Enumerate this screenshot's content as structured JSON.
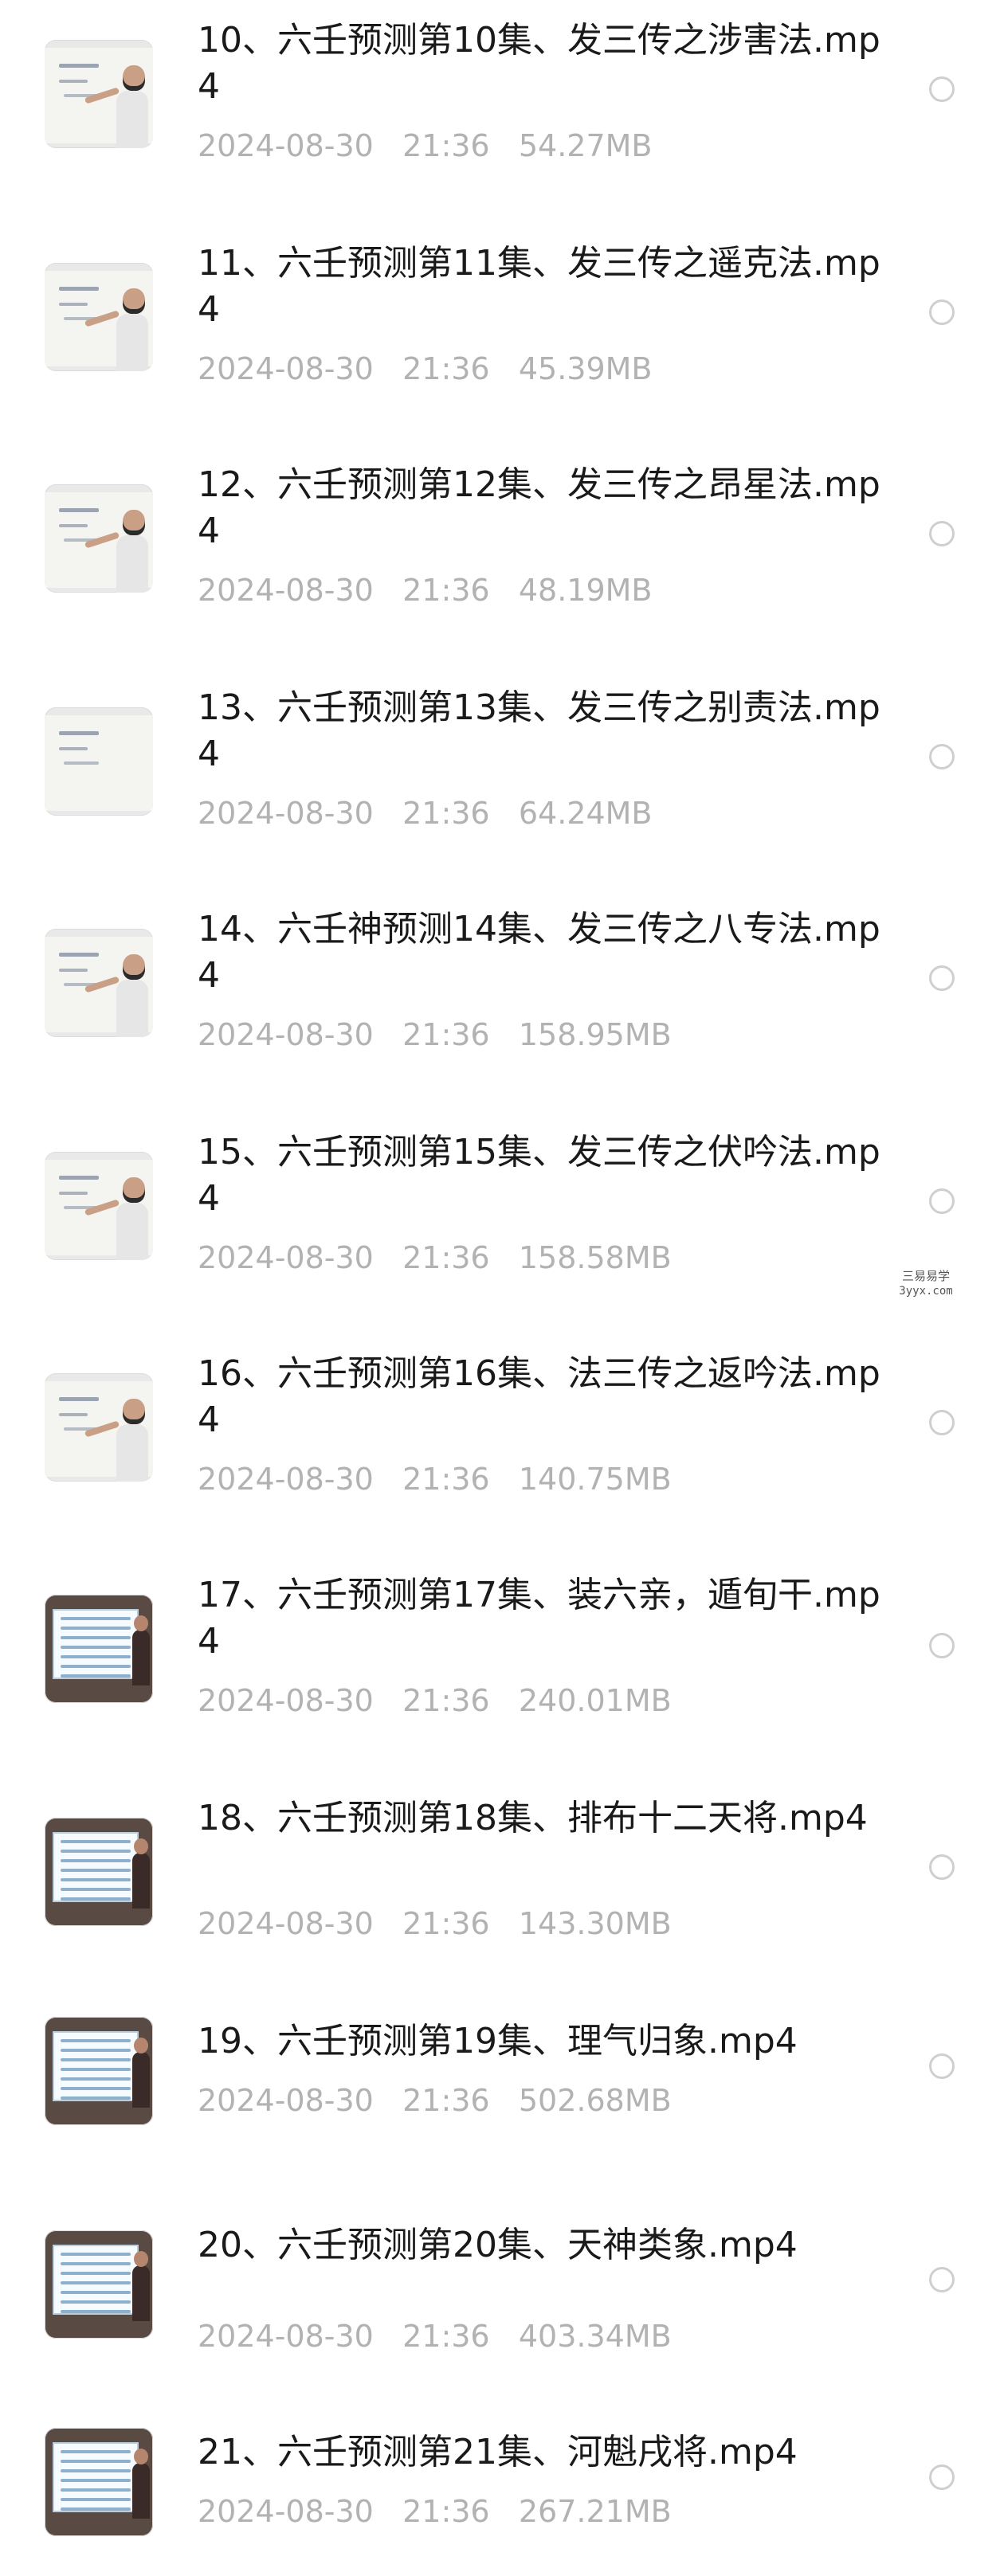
{
  "files": [
    {
      "title": "10、六壬预测第10集、发三传之涉害法.mp4",
      "date": "2024-08-30",
      "time": "21:36",
      "size": "54.27MB",
      "thumb": "whiteboard"
    },
    {
      "title": "11、六壬预测第11集、发三传之遥克法.mp4",
      "date": "2024-08-30",
      "time": "21:36",
      "size": "45.39MB",
      "thumb": "whiteboard"
    },
    {
      "title": "12、六壬预测第12集、发三传之昂星法.mp4",
      "date": "2024-08-30",
      "time": "21:36",
      "size": "48.19MB",
      "thumb": "whiteboard"
    },
    {
      "title": "13、六壬预测第13集、发三传之别责法.mp4",
      "date": "2024-08-30",
      "time": "21:36",
      "size": "64.24MB",
      "thumb": "whiteboard-empty"
    },
    {
      "title": "14、六壬神预测14集、发三传之八专法.mp4",
      "date": "2024-08-30",
      "time": "21:36",
      "size": "158.95MB",
      "thumb": "whiteboard"
    },
    {
      "title": "15、六壬预测第15集、发三传之伏吟法.mp4",
      "date": "2024-08-30",
      "time": "21:36",
      "size": "158.58MB",
      "thumb": "whiteboard"
    },
    {
      "title": "16、六壬预测第16集、法三传之返吟法.mp4",
      "date": "2024-08-30",
      "time": "21:36",
      "size": "140.75MB",
      "thumb": "whiteboard"
    },
    {
      "title": "17、六壬预测第17集、装六亲，遁旬干.mp4",
      "date": "2024-08-30",
      "time": "21:36",
      "size": "240.01MB",
      "thumb": "slides"
    },
    {
      "title": "18、六壬预测第18集、排布十二天将.mp4",
      "date": "2024-08-30",
      "time": "21:36",
      "size": "143.30MB",
      "thumb": "slides"
    },
    {
      "title": "19、六壬预测第19集、理气归象.mp4",
      "date": "2024-08-30",
      "time": "21:36",
      "size": "502.68MB",
      "thumb": "slides"
    },
    {
      "title": "20、六壬预测第20集、天神类象.mp4",
      "date": "2024-08-30",
      "time": "21:36",
      "size": "403.34MB",
      "thumb": "slides"
    },
    {
      "title": "21、六壬预测第21集、河魁戌将.mp4",
      "date": "2024-08-30",
      "time": "21:36",
      "size": "267.21MB",
      "thumb": "slides"
    }
  ],
  "watermark": {
    "line1": "三易易学",
    "line2": "3yyx.com"
  },
  "colors": {
    "title": "#1a1a1a",
    "meta": "#b2b2b2",
    "radio_border": "#cfcfcf"
  }
}
